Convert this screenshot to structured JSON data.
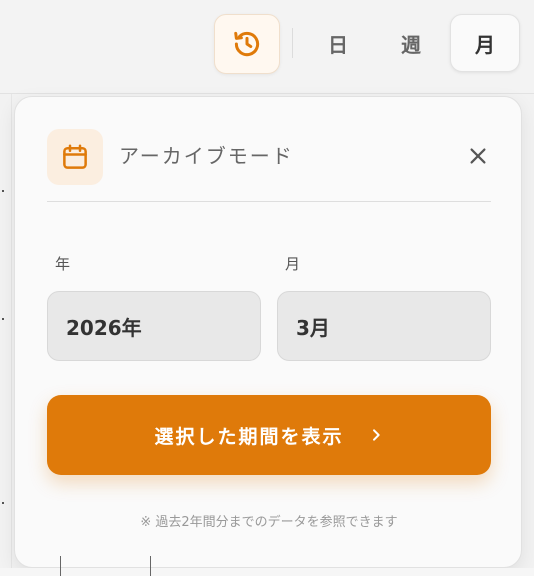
{
  "toolbar": {
    "history_icon": "history-icon",
    "view_options": [
      "日",
      "週",
      "月"
    ],
    "selected_view": "月",
    "accent_color": "#df7a0a"
  },
  "archive_popover": {
    "title": "アーカイブモード",
    "title_icon": "calendar-icon",
    "close_icon": "close-icon",
    "year": {
      "label": "年",
      "value": "2026年"
    },
    "month": {
      "label": "月",
      "value": "3月"
    },
    "show_button_label": "選択した期間を表示",
    "note": "※ 過去2年間分までのデータを参照できます"
  }
}
